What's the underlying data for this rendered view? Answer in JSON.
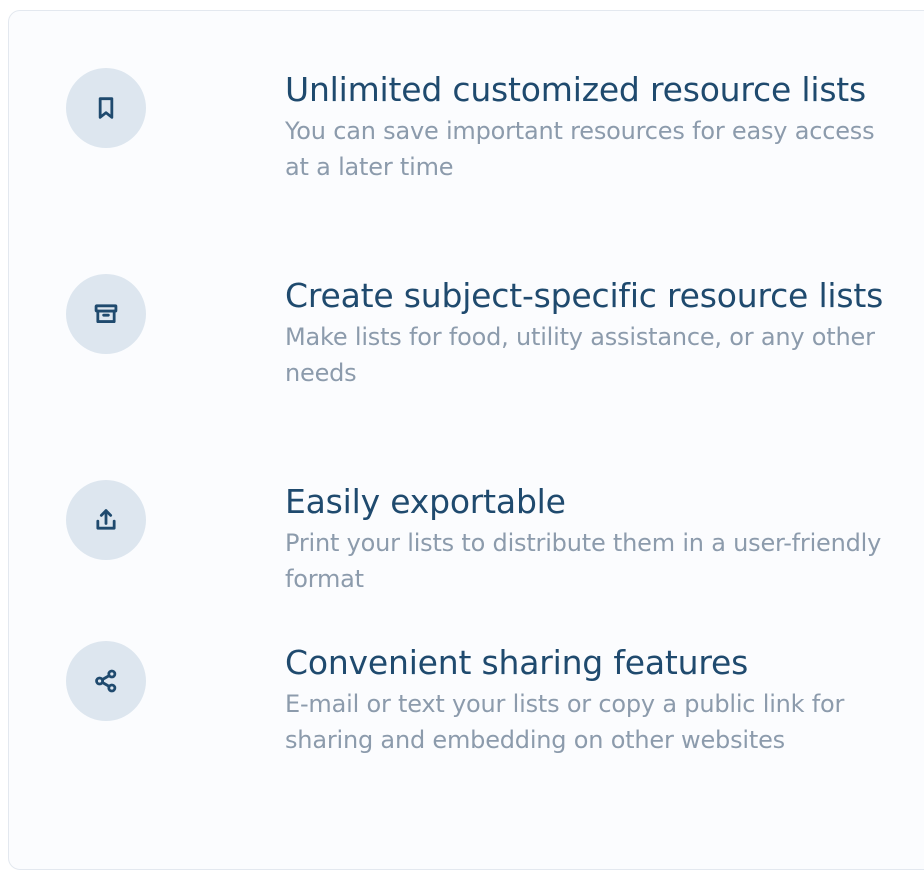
{
  "features": [
    {
      "icon": "bookmark-icon",
      "title": "Unlimited customized resource lists",
      "description": "You can save important resources for easy access at a later time"
    },
    {
      "icon": "archive-box-icon",
      "title": "Create subject-specific resource lists",
      "description": "Make lists for food, utility assistance, or any other needs"
    },
    {
      "icon": "upload-share-icon",
      "title": "Easily exportable",
      "description": "Print your lists to distribute them in a user-friendly format"
    },
    {
      "icon": "share-nodes-icon",
      "title": "Convenient sharing features",
      "description": "E-mail or text your lists or copy a public link for sharing and embedding on other websites"
    }
  ],
  "colors": {
    "title": "#1f4a6e",
    "description": "#8c9bac",
    "icon_background": "#dde6ef",
    "card_background": "#fbfcfe"
  }
}
